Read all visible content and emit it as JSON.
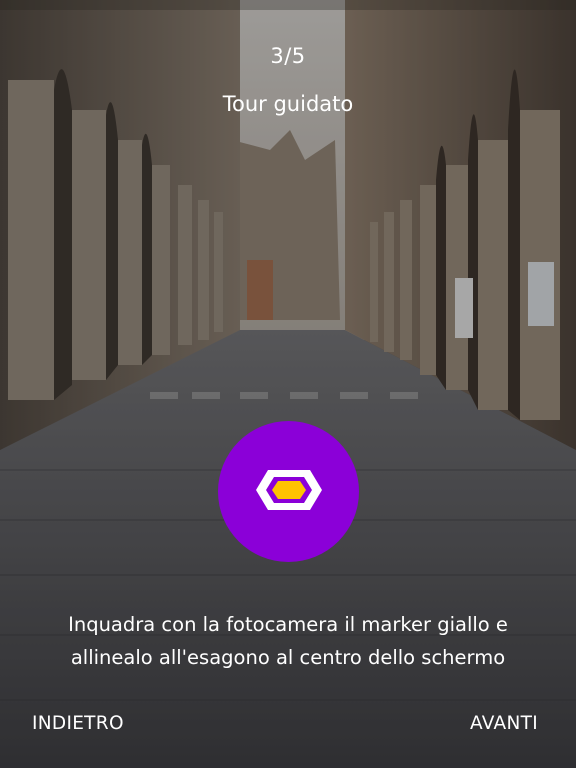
{
  "header": {
    "step_indicator": "3/5",
    "title": "Tour guidato"
  },
  "marker": {
    "icon": "hexagon-marker-icon",
    "circle_color": "#8b00d8",
    "hexagon_fill": "#ffc300",
    "hexagon_stroke": "#ffffff"
  },
  "instruction": {
    "line1": "Inquadra con la fotocamera il marker giallo e",
    "line2": "allinealo all'esagono al centro dello schermo"
  },
  "navigation": {
    "back_label": "INDIETRO",
    "next_label": "AVANTI"
  }
}
